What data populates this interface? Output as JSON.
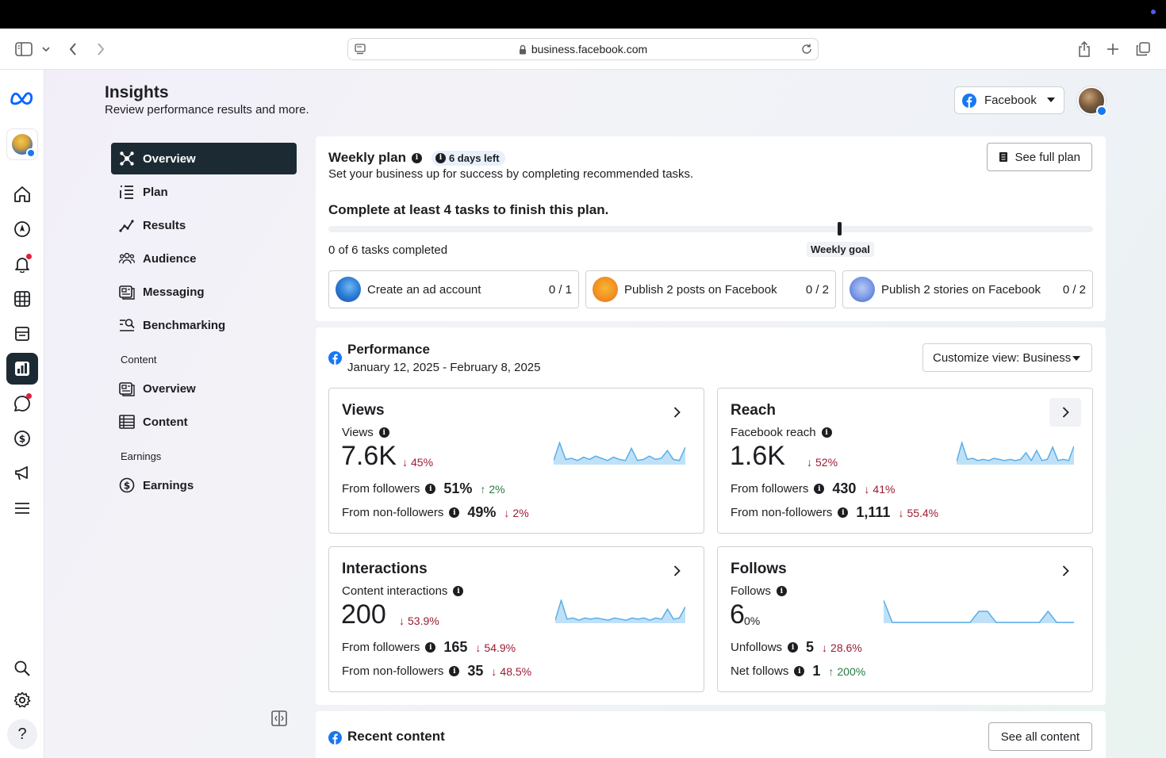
{
  "browser": {
    "url": "business.facebook.com"
  },
  "colors": {
    "fb_blue": "#1877f2",
    "dark_nav": "#1c2b33",
    "down": "#9b1c31",
    "up": "#2a7a45",
    "spark_line": "#5aaee8",
    "spark_fill": "#bfe1f8"
  },
  "header": {
    "title": "Insights",
    "subtitle": "Review performance results and more.",
    "platform_select": "Facebook"
  },
  "sidebar": {
    "items": [
      {
        "label": "Overview",
        "icon": "overview-icon",
        "active": true
      },
      {
        "label": "Plan",
        "icon": "plan-list-icon"
      },
      {
        "label": "Results",
        "icon": "results-trend-icon"
      },
      {
        "label": "Audience",
        "icon": "audience-people-icon"
      },
      {
        "label": "Messaging",
        "icon": "messaging-icon"
      },
      {
        "label": "Benchmarking",
        "icon": "benchmark-search-icon"
      }
    ],
    "content_section": "Content",
    "content_items": [
      {
        "label": "Overview",
        "icon": "content-overview-icon"
      },
      {
        "label": "Content",
        "icon": "content-table-icon"
      }
    ],
    "earnings_section": "Earnings",
    "earnings_items": [
      {
        "label": "Earnings",
        "icon": "earnings-dollar-icon"
      }
    ]
  },
  "weekly_plan": {
    "title": "Weekly plan",
    "days_left": "6 days left",
    "subtitle": "Set your business up for success by completing recommended tasks.",
    "see_full_plan": "See full plan",
    "goal_title": "Complete at least 4 tasks to finish this plan.",
    "progress_fraction": 0,
    "tasks_completed": "0 of 6 tasks completed",
    "weekly_goal_label": "Weekly goal",
    "tasks": [
      {
        "label": "Create an ad account",
        "count": "0 / 1"
      },
      {
        "label": "Publish 2 posts on Facebook",
        "count": "0 / 2"
      },
      {
        "label": "Publish 2 stories on Facebook",
        "count": "0 / 2"
      }
    ]
  },
  "performance": {
    "title": "Performance",
    "date_range": "January 12, 2025 - February 8, 2025",
    "customize_view": "Customize view: Business",
    "cards": [
      {
        "title": "Views",
        "metric_label": "Views",
        "value": "7.6K",
        "delta": "45%",
        "delta_dir": "down",
        "row1_label": "From followers",
        "row1_value": "51%",
        "row1_delta": "2%",
        "row1_dir": "up",
        "row2_label": "From non-followers",
        "row2_value": "49%",
        "row2_delta": "2%",
        "row2_dir": "down",
        "spark": [
          0.15,
          0.95,
          0.2,
          0.25,
          0.15,
          0.3,
          0.2,
          0.35,
          0.25,
          0.15,
          0.3,
          0.2,
          0.15,
          0.7,
          0.15,
          0.2,
          0.35,
          0.2,
          0.25,
          0.6,
          0.2,
          0.15,
          0.75
        ]
      },
      {
        "title": "Reach",
        "metric_label": "Facebook reach",
        "value": "1.6K",
        "delta": "52%",
        "delta_dir": "down",
        "row1_label": "From followers",
        "row1_value": "430",
        "row1_delta": "41%",
        "row1_dir": "down",
        "row2_label": "From non-followers",
        "row2_value": "1,111",
        "row2_delta": "55.4%",
        "row2_dir": "down",
        "spark": [
          0.1,
          0.95,
          0.2,
          0.25,
          0.15,
          0.2,
          0.15,
          0.25,
          0.2,
          0.15,
          0.2,
          0.15,
          0.2,
          0.5,
          0.15,
          0.6,
          0.15,
          0.2,
          0.75,
          0.15,
          0.2,
          0.15,
          0.8
        ]
      },
      {
        "title": "Interactions",
        "metric_label": "Content interactions",
        "value": "200",
        "delta": "53.9%",
        "delta_dir": "down",
        "row1_label": "From followers",
        "row1_value": "165",
        "row1_delta": "54.9%",
        "row1_dir": "down",
        "row2_label": "From non-followers",
        "row2_value": "35",
        "row2_delta": "48.5%",
        "row2_dir": "down",
        "spark": [
          0.1,
          1.0,
          0.15,
          0.2,
          0.1,
          0.2,
          0.15,
          0.2,
          0.15,
          0.1,
          0.2,
          0.15,
          0.1,
          0.2,
          0.15,
          0.2,
          0.1,
          0.2,
          0.15,
          0.6,
          0.15,
          0.2,
          0.7
        ]
      },
      {
        "title": "Follows",
        "metric_label": "Follows",
        "value": "6",
        "delta": "0%",
        "delta_dir": "neutral",
        "row1_label": "Unfollows",
        "row1_value": "5",
        "row1_delta": "28.6%",
        "row1_dir": "down",
        "row2_label": "Net follows",
        "row2_value": "1",
        "row2_delta": "200%",
        "row2_dir": "up",
        "spark": [
          1.0,
          0.0,
          0.0,
          0.0,
          0.0,
          0.0,
          0.0,
          0.0,
          0.0,
          0.0,
          0.0,
          0.5,
          0.5,
          0.0,
          0.0,
          0.0,
          0.0,
          0.0,
          0.0,
          0.5,
          0.0,
          0.0,
          0.0
        ]
      }
    ]
  },
  "recent_content": {
    "title": "Recent content",
    "see_all": "See all content"
  }
}
